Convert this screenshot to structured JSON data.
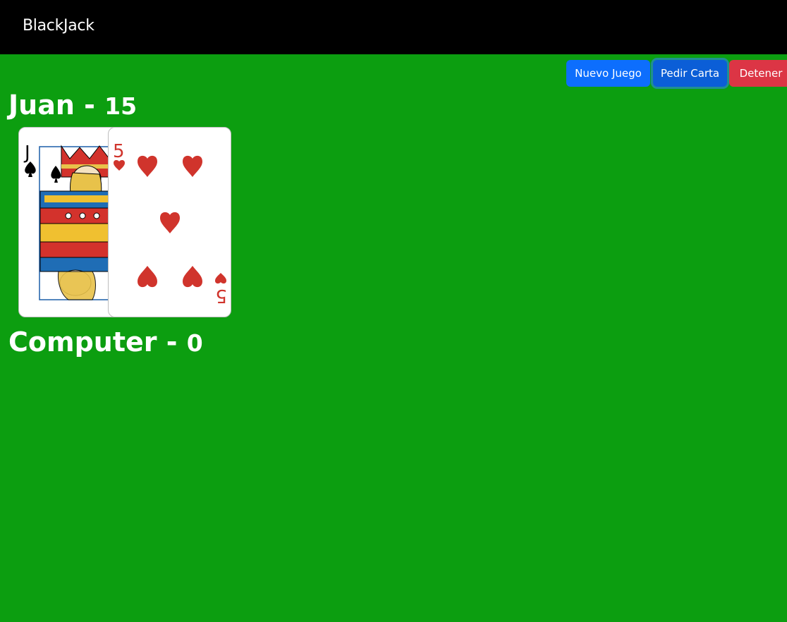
{
  "navbar": {
    "brand": "BlackJack"
  },
  "buttons": {
    "new_game": "Nuevo Juego",
    "ask_card": "Pedir Carta",
    "stop": "Detener"
  },
  "players": [
    {
      "name": "Juan",
      "separator": "-",
      "score": "15",
      "cards": [
        {
          "rank": "J",
          "suit": "spades",
          "color": "#000000"
        },
        {
          "rank": "5",
          "suit": "hearts",
          "color": "#d0342c"
        }
      ]
    },
    {
      "name": "Computer",
      "separator": "-",
      "score": "0",
      "cards": []
    }
  ],
  "colors": {
    "table": "#0c9e10",
    "navbar": "#000000",
    "primary": "#0d6efd",
    "danger": "#dc3545"
  }
}
